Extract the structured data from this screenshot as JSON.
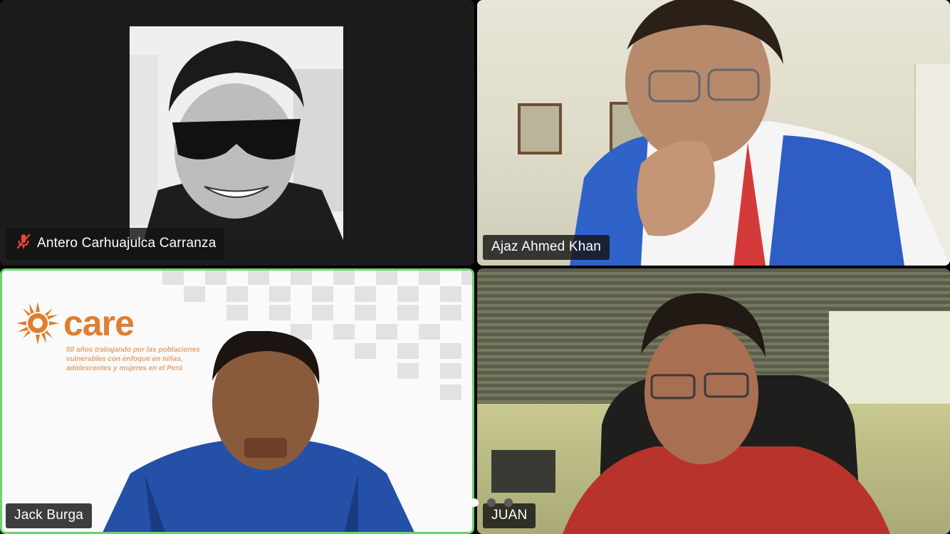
{
  "participants": [
    {
      "name": "Antero Carhuajulca Carranza",
      "muted": true,
      "video": false
    },
    {
      "name": "Ajaz Ahmed Khan",
      "muted": false,
      "video": true
    },
    {
      "name": "Jack Burga",
      "muted": false,
      "video": true,
      "active_speaker": true
    },
    {
      "name": "JUAN",
      "muted": false,
      "video": true
    }
  ],
  "virtual_background": {
    "brand": "care",
    "tagline": "50 años trabajando por las poblaciones vulnerables con enfoque en niñas, adolescentes y mujeres en el Perú"
  },
  "colors": {
    "active_speaker_border": "#6cd26a",
    "muted_icon": "#e8453c",
    "care_orange": "#e07e2f"
  },
  "icons": {
    "muted": "mic-muted-icon"
  },
  "pagination": {
    "pages": 3,
    "current": 1
  }
}
